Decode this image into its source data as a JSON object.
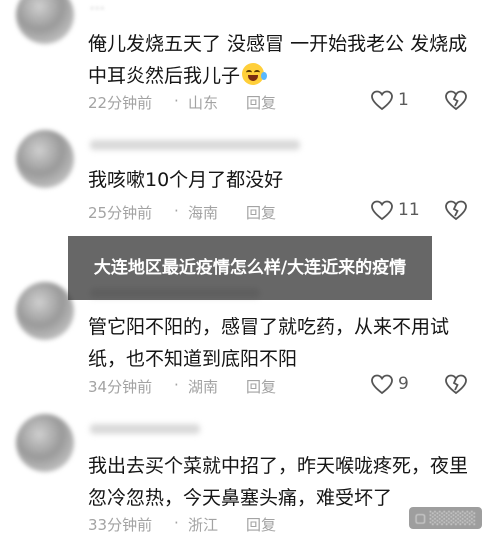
{
  "overlay": {
    "title": "大连地区最近疫情怎么样/大连近来的疫情"
  },
  "comments": [
    {
      "username": "···",
      "text": "俺儿发烧五天了 没感冒  一开始我老公 发烧成中耳炎然后我儿子",
      "emoji": "laughing-tears-emoji",
      "time": "22分钟前",
      "location": "山东",
      "reply": "回复",
      "likes": "1"
    },
    {
      "username": "",
      "text": "我咳嗽10个月了都没好",
      "time": "25分钟前",
      "location": "海南",
      "reply": "回复",
      "likes": "11"
    },
    {
      "username": "",
      "text": "管它阳不阳的，感冒了就吃药，从来不用试纸，也不知道到底阳不阳",
      "time": "34分钟前",
      "location": "湖南",
      "reply": "回复",
      "likes": "9"
    },
    {
      "username": "",
      "text": "我出去买个菜就中招了，昨天喉咙疼死，夜里忽冷忽热，今天鼻塞头痛，难受坏了",
      "time": "33分钟前",
      "location": "浙江",
      "reply": "回复",
      "likes": ""
    }
  ],
  "separator_dot": "·",
  "colors": {
    "overlay_bg": "#3c3c3c",
    "meta_text": "#a3a3a3",
    "text": "#151515"
  },
  "icons": {
    "like": "heart-outline-icon",
    "dislike": "broken-heart-icon"
  }
}
